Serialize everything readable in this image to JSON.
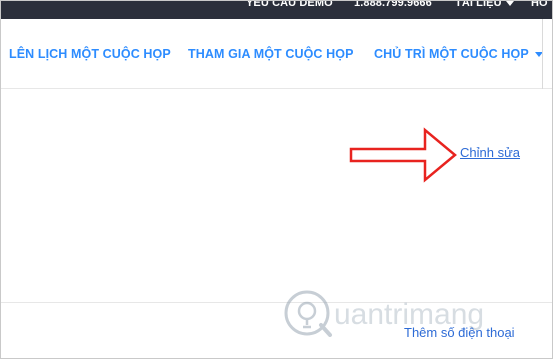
{
  "topbar": {
    "demo_label": "YÊU CẦU DEMO",
    "phone": "1.888.799.9666",
    "resources_label": "TÀI LIỆU",
    "support_label": "HỖ"
  },
  "nav": {
    "items": [
      {
        "label": "LÊN LỊCH MỘT CUỘC HỌP"
      },
      {
        "label": "THAM GIA MỘT CUỘC HỌP"
      },
      {
        "label": "CHỦ TRÌ MỘT CUỘC HỌP"
      }
    ]
  },
  "content": {
    "edit_label": "Chỉnh sửa",
    "add_phone_label": "Thêm số điện thoại"
  },
  "watermark": {
    "brand": "uantrimang"
  },
  "colors": {
    "topbar_bg": "#2b2f3b",
    "nav_link": "#2d8cff",
    "link": "#2d6bd6",
    "annotation_arrow": "#e8231f"
  }
}
